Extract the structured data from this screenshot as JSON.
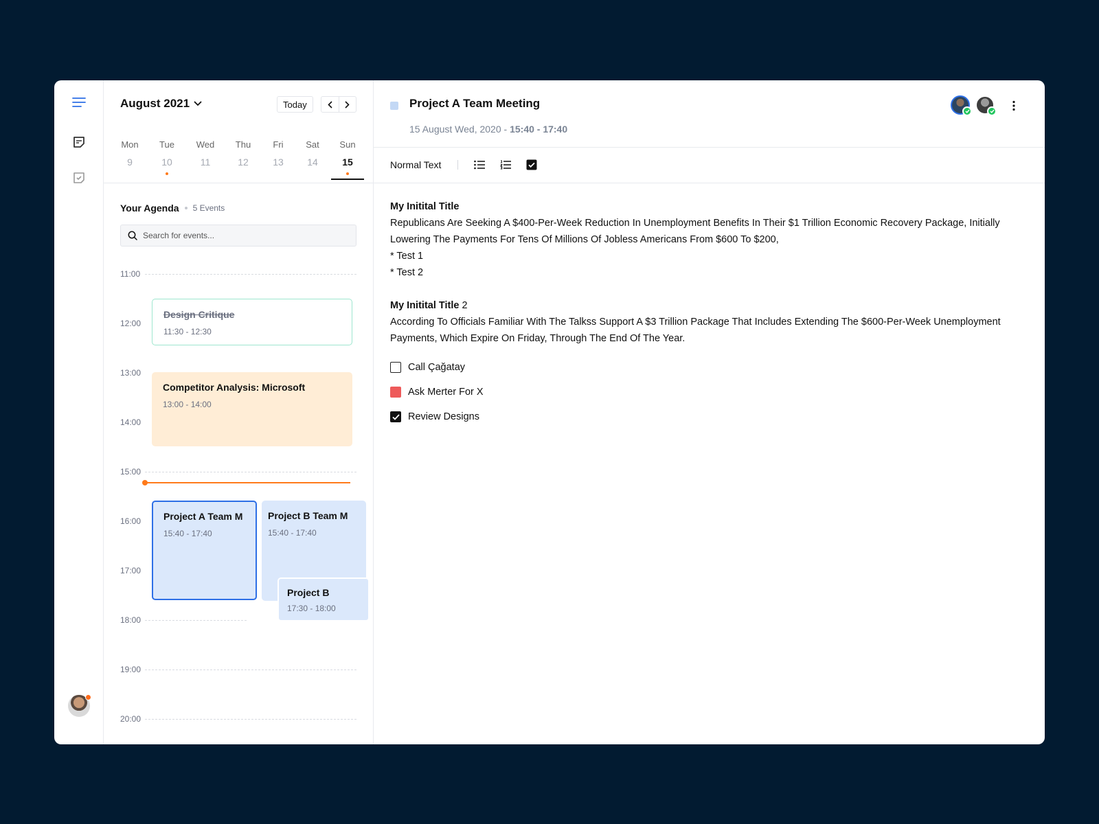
{
  "calendar": {
    "month_label": "August 2021",
    "today_label": "Today",
    "week": [
      {
        "name": "Mon",
        "date": "9",
        "has_event": false,
        "active": false
      },
      {
        "name": "Tue",
        "date": "10",
        "has_event": true,
        "active": false
      },
      {
        "name": "Wed",
        "date": "11",
        "has_event": false,
        "active": false
      },
      {
        "name": "Thu",
        "date": "12",
        "has_event": false,
        "active": false
      },
      {
        "name": "Fri",
        "date": "13",
        "has_event": false,
        "active": false
      },
      {
        "name": "Sat",
        "date": "14",
        "has_event": false,
        "active": false
      },
      {
        "name": "Sun",
        "date": "15",
        "has_event": true,
        "active": true
      }
    ],
    "agenda_title": "Your Agenda",
    "agenda_count": "5 Events",
    "search_placeholder": "Search for events...",
    "hours": [
      "11:00",
      "12:00",
      "13:00",
      "14:00",
      "15:00",
      "16:00",
      "17:00",
      "18:00",
      "19:00",
      "20:00"
    ],
    "events": {
      "design": {
        "title": "Design Critique",
        "time": "11:30 - 12:30"
      },
      "competitor": {
        "title": "Competitor Analysis: Microsoft",
        "time": "13:00 - 14:00"
      },
      "project_a": {
        "title": "Project A Team M",
        "time": "15:40 - 17:40"
      },
      "project_b": {
        "title": "Project B Team M",
        "time": "15:40 - 17:40"
      },
      "project_b2": {
        "title": "Project B",
        "time": "17:30 - 18:00"
      }
    }
  },
  "detail": {
    "title": "Project A Team Meeting",
    "date_prefix": "15 August Wed, 2020 - ",
    "time_range": "15:40 - 17:40",
    "toolbar": {
      "format_label": "Normal Text"
    },
    "doc": {
      "title1": "My Initital Title",
      "para1": "Republicans Are Seeking A $400-Per-Week Reduction In Unemployment Benefits In Their $1 Trillion Economic Recovery Package, Initially Lowering The Payments For Tens Of Millions Of Jobless Americans From $600 To $200,",
      "bullet1": "* Test 1",
      "bullet2": "* Test 2",
      "title2": "My Initital Title",
      "title2_suffix": " 2",
      "para2": "According To Officials Familiar With The Talkss Support A $3 Trillion Package That Includes Extending The $600-Per-Week Unemployment Payments, Which Expire On Friday, Through The End Of The Year."
    },
    "todos": [
      {
        "label": "Call Çağatay",
        "state": "unchecked"
      },
      {
        "label": "Ask Merter For X",
        "state": "flagged"
      },
      {
        "label": "Review Designs",
        "state": "checked"
      }
    ]
  },
  "colors": {
    "background": "#021b31",
    "accent": "#2d6fe6",
    "now_line": "#ff7a1a",
    "flag": "#ee5a5a",
    "event_blue": "#dbe8fb",
    "event_orange": "#ffedd6"
  }
}
